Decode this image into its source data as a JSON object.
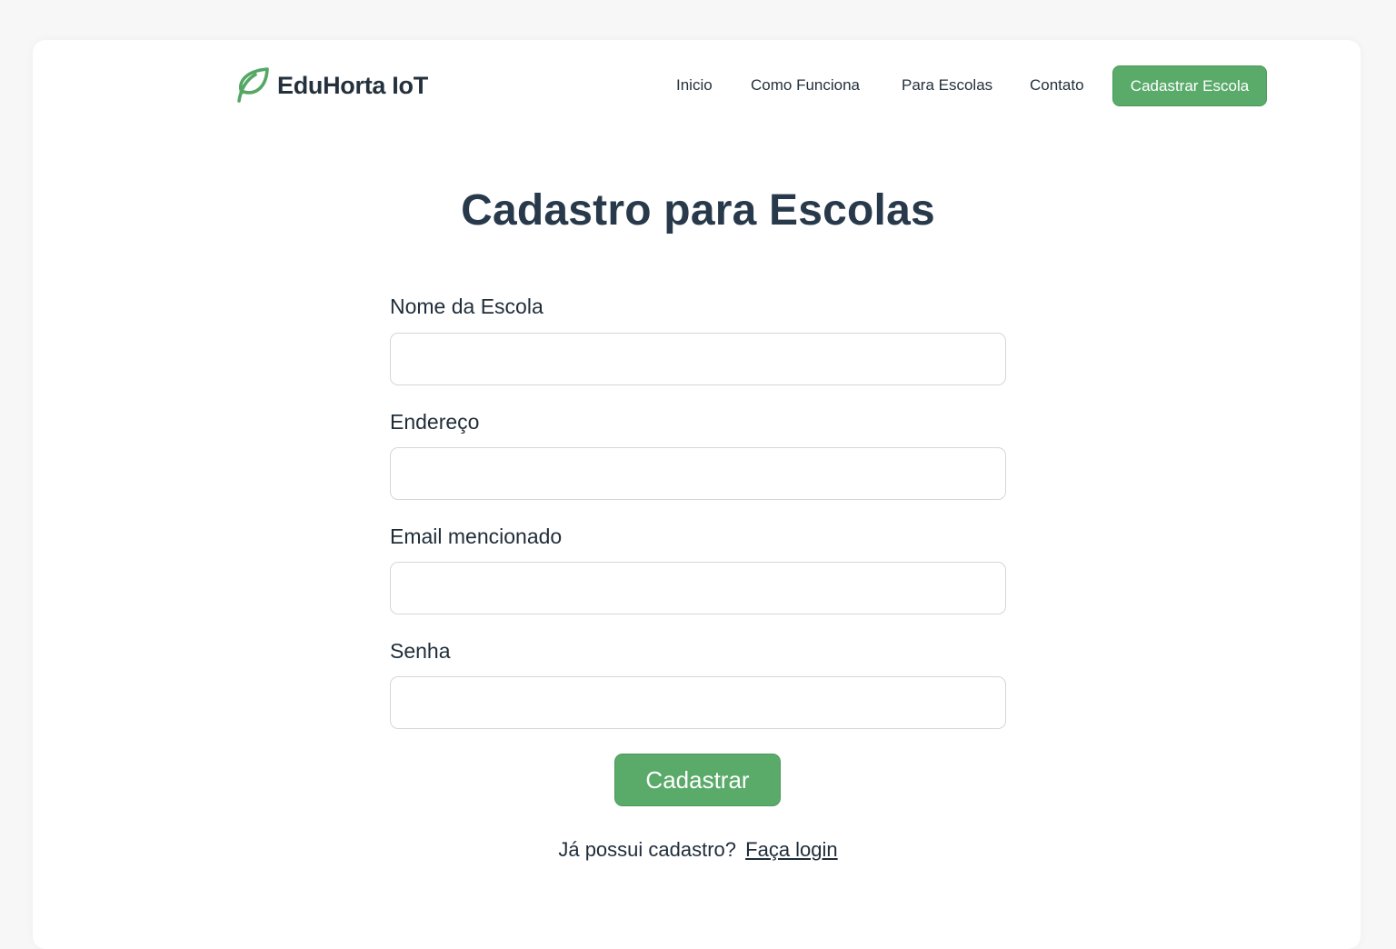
{
  "header": {
    "brand": "EduHorta IoT",
    "nav": [
      {
        "label": "Inicio"
      },
      {
        "label": "Como Funciona"
      },
      {
        "label": "Para Escolas"
      },
      {
        "label": "Contato"
      }
    ],
    "cta_label": "Cadastrar Escola"
  },
  "page": {
    "title": "Cadastro para Escolas"
  },
  "form": {
    "fields": [
      {
        "label": "Nome da Escola",
        "value": "",
        "placeholder": ""
      },
      {
        "label": "Endereço",
        "value": "",
        "placeholder": ""
      },
      {
        "label": "Email mencionado",
        "value": "",
        "placeholder": ""
      },
      {
        "label": "Senha",
        "value": "",
        "placeholder": ""
      }
    ],
    "submit_label": "Cadastrar",
    "login_prompt": "Já possui cadastro?",
    "login_link": "Faça login"
  },
  "colors": {
    "accent": "#5aaa6a",
    "text": "#1f2d3a",
    "title": "#27394a"
  },
  "icons": {
    "logo": "leaf-icon"
  }
}
